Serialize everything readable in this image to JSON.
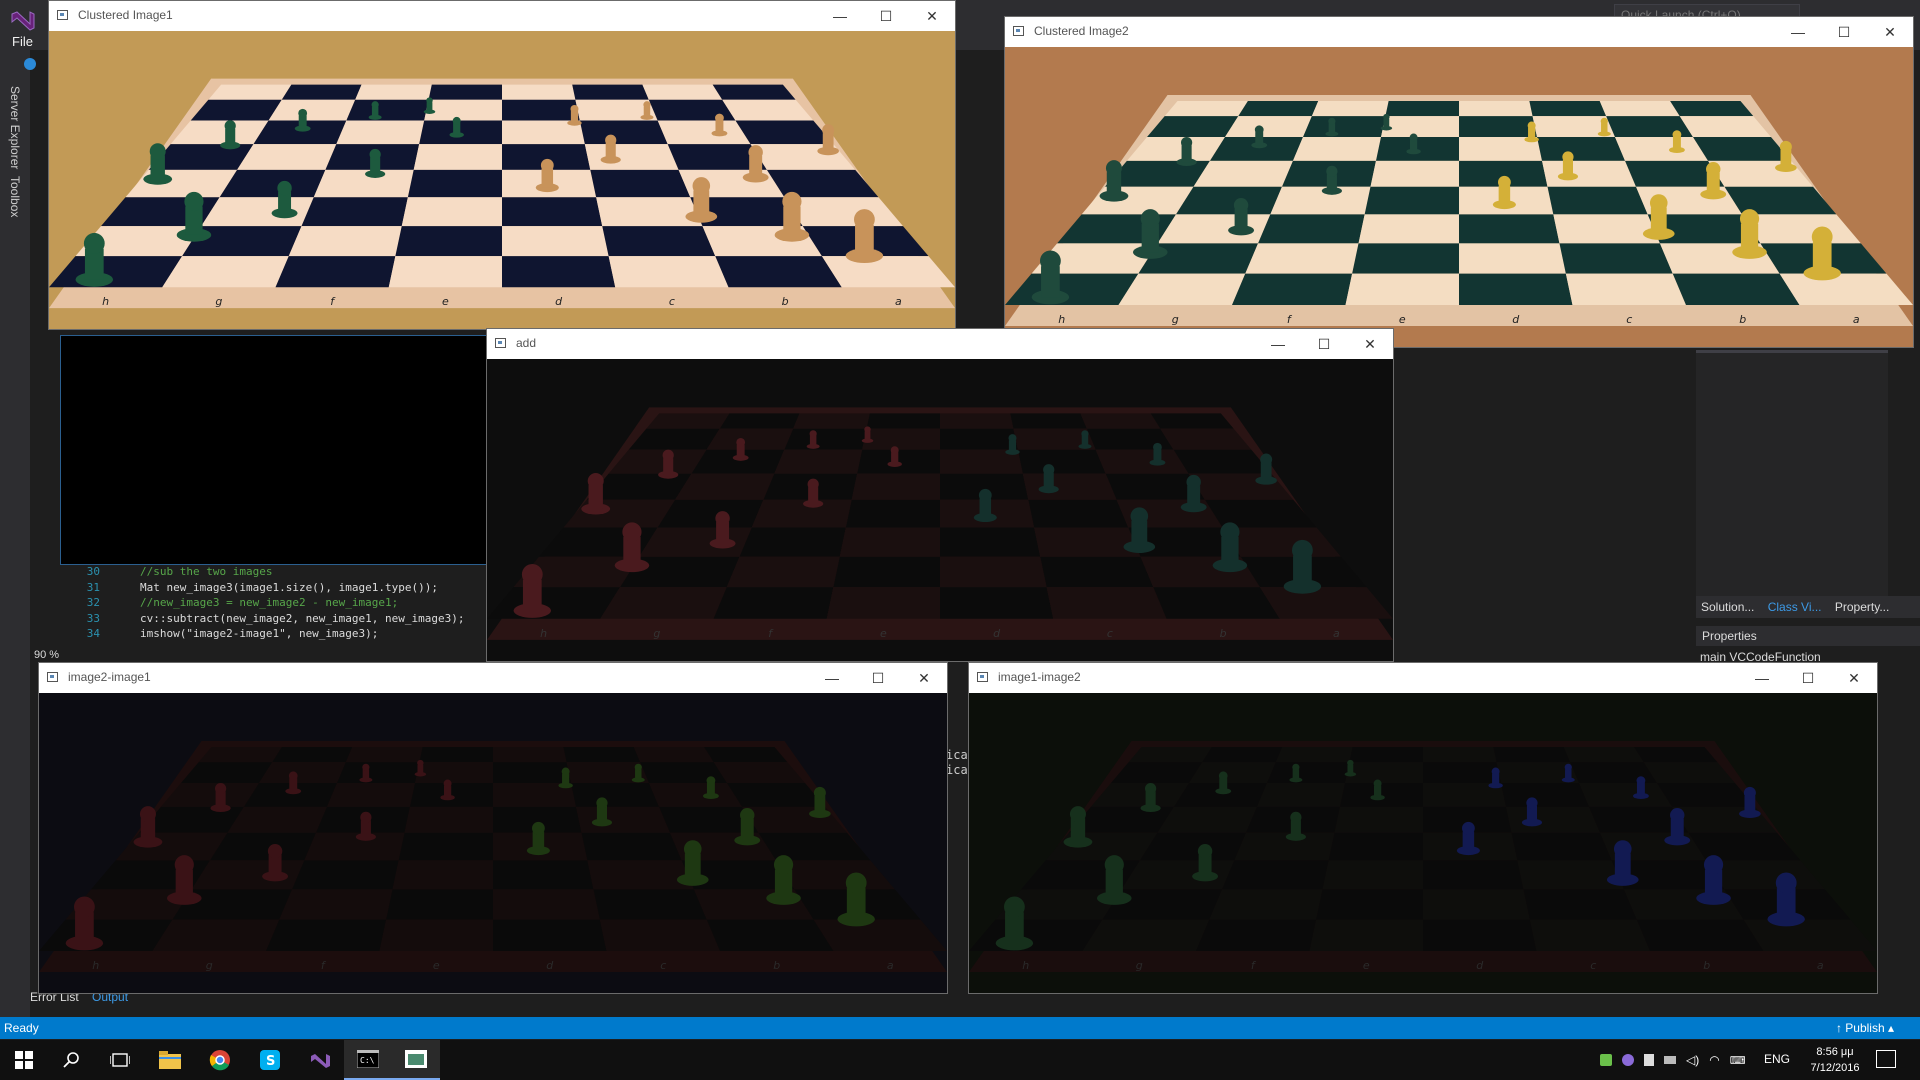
{
  "vs": {
    "menu_file": "File",
    "quick_launch_placeholder": "Quick Launch (Ctrl+Q)",
    "left_tabs": [
      "Server Explorer",
      "Toolbox"
    ],
    "code_lines": [
      {
        "num": "30",
        "text": "//sub the two images",
        "kind": "comment"
      },
      {
        "num": "31",
        "text": "Mat new_image3(image1.size(), image1.type());",
        "kind": "code"
      },
      {
        "num": "32",
        "text": "//new_image3 = new_image2 - new_image1;",
        "kind": "comment"
      },
      {
        "num": "33",
        "text": "cv::subtract(new_image2, new_image1, new_image3);",
        "kind": "code"
      },
      {
        "num": "34",
        "text": "imshow(\"image2-image1\", new_image3);",
        "kind": "code"
      }
    ],
    "zoom_level": "90 %",
    "right_tabs": [
      "Solution...",
      "Class Vi...",
      "Property..."
    ],
    "properties_title": "Properties",
    "properties_value": "main  VCCodeFunction",
    "console_fragment": [
      "ica",
      "ica"
    ],
    "bottom_tabs": [
      "Error List",
      "Output"
    ],
    "status_ready": "Ready",
    "publish_label": "Publish",
    "colors": {
      "accent": "#007acc",
      "chrome": "#2d2d30",
      "editor": "#1e1e1e"
    }
  },
  "windows": [
    {
      "id": "clustered1",
      "title": "Clustered Image1",
      "variant": "clustered-warm"
    },
    {
      "id": "clustered2",
      "title": "Clustered Image2",
      "variant": "clustered-yellow"
    },
    {
      "id": "add",
      "title": "add",
      "variant": "dark-diff"
    },
    {
      "id": "img21",
      "title": "image2-image1",
      "variant": "dark-diff-red"
    },
    {
      "id": "img12",
      "title": "image1-image2",
      "variant": "dark-diff-blue"
    }
  ],
  "window_controls": {
    "minimize": "—",
    "maximize": "☐",
    "close": "✕"
  },
  "board_files": [
    "h",
    "g",
    "f",
    "e",
    "d",
    "c",
    "b",
    "a"
  ],
  "taskbar": {
    "apps": [
      "start-icon",
      "search-icon",
      "task-view-icon",
      "file-explorer-icon",
      "chrome-icon",
      "skype-icon",
      "visual-studio-icon",
      "console-icon",
      "image-viewer-icon"
    ],
    "language": "ENG",
    "time": "8:56 μμ",
    "date": "7/12/2016"
  }
}
